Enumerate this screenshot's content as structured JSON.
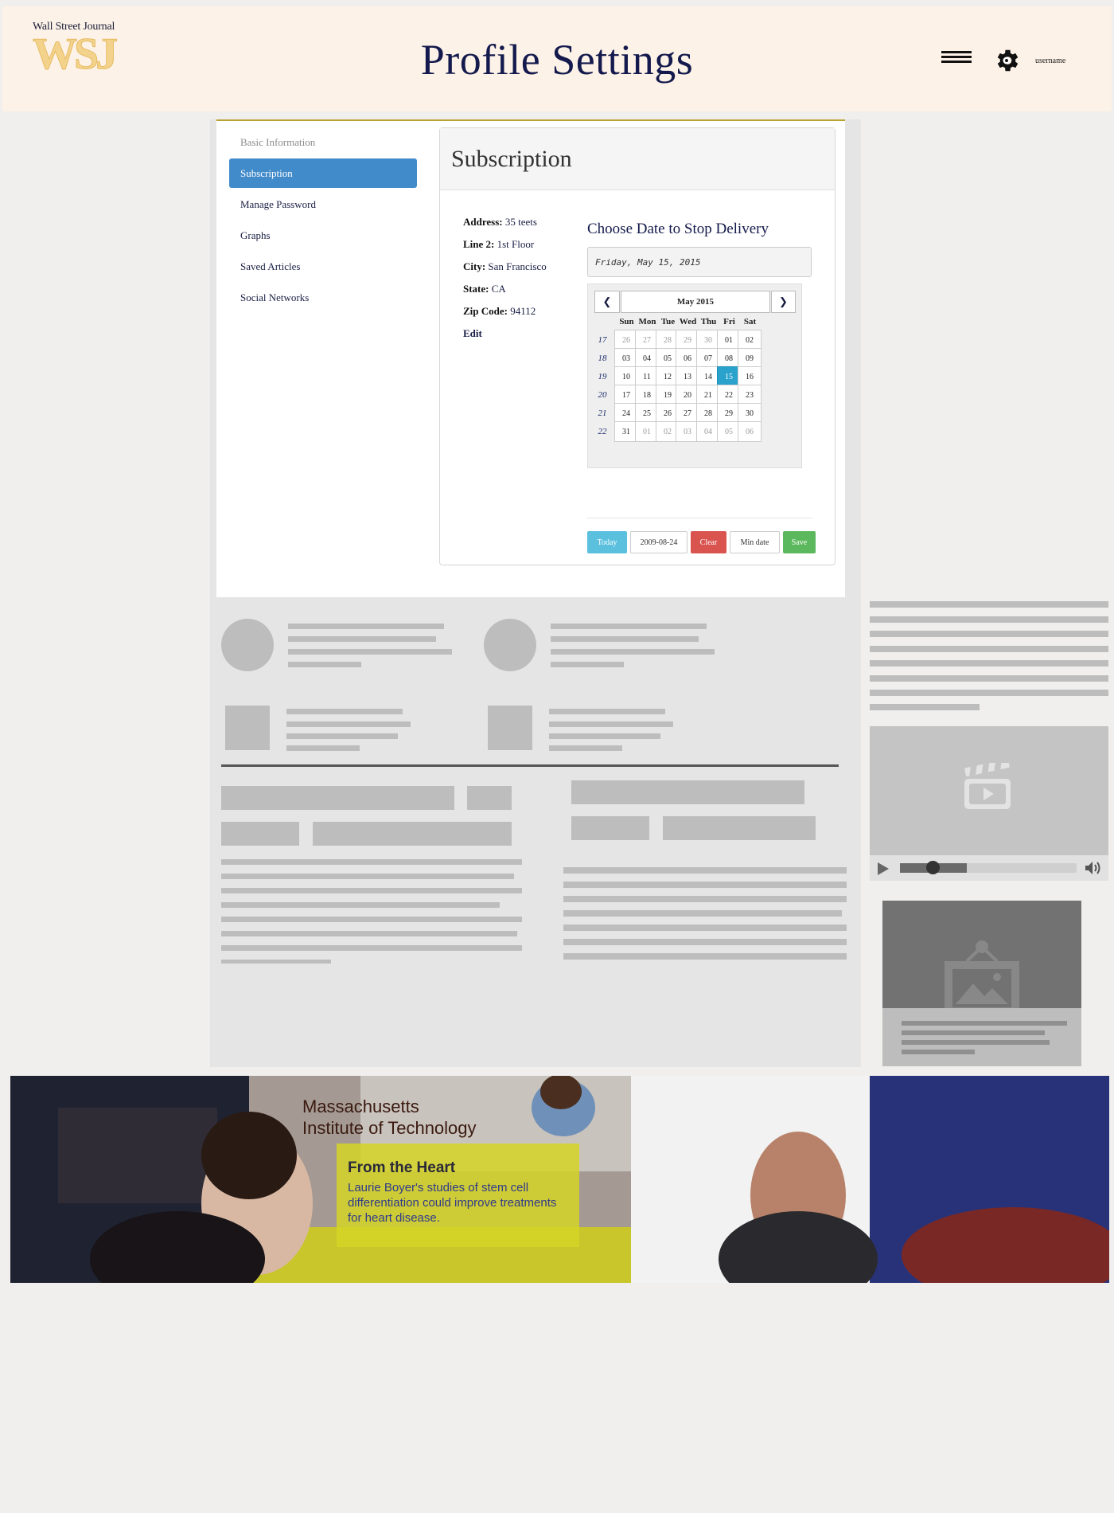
{
  "header": {
    "logo_small": "Wall Street Journal",
    "logo_big": "WSJ",
    "title": "Profile Settings",
    "username": "username"
  },
  "sidebar": {
    "items": [
      {
        "label": "Basic Information",
        "state": "muted"
      },
      {
        "label": "Subscription",
        "state": "active"
      },
      {
        "label": "Manage Password",
        "state": "default"
      },
      {
        "label": "Graphs",
        "state": "default"
      },
      {
        "label": "Saved Articles",
        "state": "default"
      },
      {
        "label": "Social Networks",
        "state": "default"
      }
    ]
  },
  "subscription": {
    "title": "Subscription",
    "address": [
      {
        "key": "Address:",
        "value": "35 teets"
      },
      {
        "key": "Line 2:",
        "value": "1st Floor"
      },
      {
        "key": "City:",
        "value": "San Francisco"
      },
      {
        "key": "State:",
        "value": "CA"
      },
      {
        "key": "Zip Code:",
        "value": "94112"
      }
    ],
    "edit_label": "Edit",
    "stop_title": "Choose Date to Stop Delivery",
    "date_value": "Friday, May 15, 2015",
    "calendar": {
      "prev_icon": "chevron-left-icon",
      "next_icon": "chevron-right-icon",
      "month": "May 2015",
      "days_of_week": [
        "Sun",
        "Mon",
        "Tue",
        "Wed",
        "Thu",
        "Fri",
        "Sat"
      ],
      "weeks": [
        {
          "num": "17",
          "days": [
            [
              "26",
              "other"
            ],
            [
              "27",
              "other"
            ],
            [
              "28",
              "other"
            ],
            [
              "29",
              "other"
            ],
            [
              "30",
              "other"
            ],
            [
              "01",
              "current"
            ],
            [
              "02",
              "current"
            ]
          ]
        },
        {
          "num": "18",
          "days": [
            [
              "03",
              "current"
            ],
            [
              "04",
              "current"
            ],
            [
              "05",
              "current"
            ],
            [
              "06",
              "current"
            ],
            [
              "07",
              "current"
            ],
            [
              "08",
              "current"
            ],
            [
              "09",
              "current"
            ]
          ]
        },
        {
          "num": "19",
          "days": [
            [
              "10",
              "current"
            ],
            [
              "11",
              "current"
            ],
            [
              "12",
              "current"
            ],
            [
              "13",
              "current"
            ],
            [
              "14",
              "current"
            ],
            [
              "15",
              "selected"
            ],
            [
              "16",
              "current"
            ]
          ]
        },
        {
          "num": "20",
          "days": [
            [
              "17",
              "current"
            ],
            [
              "18",
              "current"
            ],
            [
              "19",
              "current"
            ],
            [
              "20",
              "current"
            ],
            [
              "21",
              "current"
            ],
            [
              "22",
              "current"
            ],
            [
              "23",
              "current"
            ]
          ]
        },
        {
          "num": "21",
          "days": [
            [
              "24",
              "current"
            ],
            [
              "25",
              "current"
            ],
            [
              "26",
              "current"
            ],
            [
              "27",
              "current"
            ],
            [
              "28",
              "current"
            ],
            [
              "29",
              "current"
            ],
            [
              "30",
              "current"
            ]
          ]
        },
        {
          "num": "22",
          "days": [
            [
              "31",
              "current"
            ],
            [
              "01",
              "other"
            ],
            [
              "02",
              "other"
            ],
            [
              "03",
              "other"
            ],
            [
              "04",
              "other"
            ],
            [
              "05",
              "other"
            ],
            [
              "06",
              "other"
            ]
          ]
        }
      ]
    },
    "buttons": {
      "today": "Today",
      "date": "2009-08-24",
      "clear": "Clear",
      "min_date": "Min date",
      "save": "Save"
    }
  },
  "video": {
    "icon": "film-clapper-icon",
    "progress": 0.38,
    "playhead": 0.15
  },
  "image_card": {
    "icon": "picture-icon"
  },
  "banner": {
    "title_line1": "Massachusetts",
    "title_line2": "Institute of Technology",
    "headline": "From the Heart",
    "body": "Laurie Boyer's studies of stem cell differentiation could improve treatments for heart disease."
  },
  "colors": {
    "header_bg": "#fdf2e7",
    "active_nav": "#428bca",
    "selected_day": "#2aa2cc",
    "today_btn": "#5bc0de",
    "clear_btn": "#d9534f",
    "save_btn": "#5cb85c"
  }
}
